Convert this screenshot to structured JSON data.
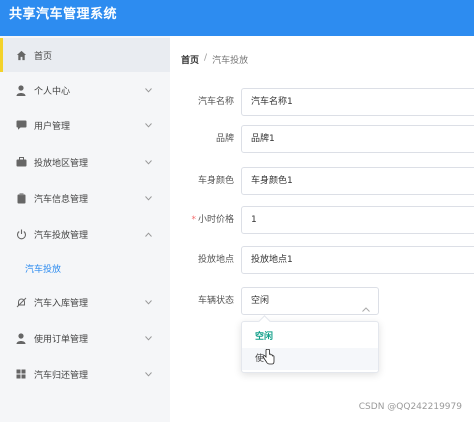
{
  "app": {
    "title": "共享汽车管理系统"
  },
  "sidebar": {
    "items": [
      {
        "label": "首页",
        "icon": "home-icon"
      },
      {
        "label": "个人中心",
        "icon": "user-icon"
      },
      {
        "label": "用户管理",
        "icon": "chat-icon"
      },
      {
        "label": "投放地区管理",
        "icon": "briefcase-icon"
      },
      {
        "label": "汽车信息管理",
        "icon": "clipboard-icon"
      },
      {
        "label": "汽车投放管理",
        "icon": "power-icon"
      },
      {
        "label": "汽车入库管理",
        "icon": "no-bell-icon"
      },
      {
        "label": "使用订单管理",
        "icon": "user-icon"
      },
      {
        "label": "汽车归还管理",
        "icon": "grid-icon"
      }
    ],
    "sub_item": "汽车投放"
  },
  "breadcrumb": {
    "home": "首页",
    "separator": "/",
    "current": "汽车投放"
  },
  "form": {
    "car_name": {
      "label": "汽车名称",
      "value": "汽车名称1"
    },
    "brand": {
      "label": "品牌",
      "value": "品牌1"
    },
    "color": {
      "label": "车身颜色",
      "value": "车身颜色1"
    },
    "hourly_price": {
      "required_mark": "*",
      "label": "小时价格",
      "value": "1"
    },
    "location": {
      "label": "投放地点",
      "value": "投放地点1"
    },
    "status": {
      "label": "车辆状态",
      "value": "空闲"
    }
  },
  "dropdown": {
    "options": [
      "空闲",
      "使"
    ]
  },
  "watermark": "CSDN @QQ242219979",
  "colors": {
    "topbar": "#2d8cf0",
    "accent": "#2d8cf0",
    "selected_option": "#13a08a"
  }
}
